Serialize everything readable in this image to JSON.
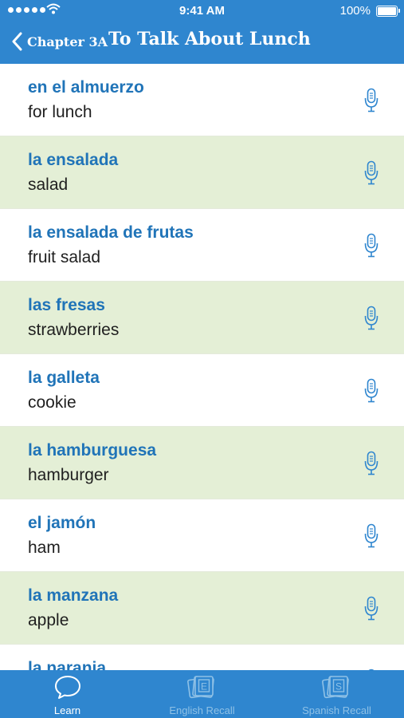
{
  "status_bar": {
    "time": "9:41 AM",
    "battery": "100%"
  },
  "nav": {
    "back_label": "Chapter 3A",
    "title": "To Talk About Lunch"
  },
  "vocab": [
    {
      "term": "en el almuerzo",
      "meaning": "for lunch"
    },
    {
      "term": "la ensalada",
      "meaning": "salad"
    },
    {
      "term": "la ensalada de frutas",
      "meaning": "fruit salad"
    },
    {
      "term": "las fresas",
      "meaning": "strawberries"
    },
    {
      "term": "la galleta",
      "meaning": "cookie"
    },
    {
      "term": "la hamburguesa",
      "meaning": "hamburger"
    },
    {
      "term": "el jamón",
      "meaning": "ham"
    },
    {
      "term": "la manzana",
      "meaning": "apple"
    },
    {
      "term": "la naranja",
      "meaning": ""
    }
  ],
  "tabs": [
    {
      "label": "Learn",
      "icon": "speech-bubble-icon",
      "active": true
    },
    {
      "label": "English Recall",
      "icon": "flashcards-e-icon",
      "active": false
    },
    {
      "label": "Spanish Recall",
      "icon": "flashcards-s-icon",
      "active": false
    }
  ],
  "colors": {
    "accent": "#2f86cf",
    "term": "#2074b8",
    "alt_row": "#e4efd6"
  }
}
